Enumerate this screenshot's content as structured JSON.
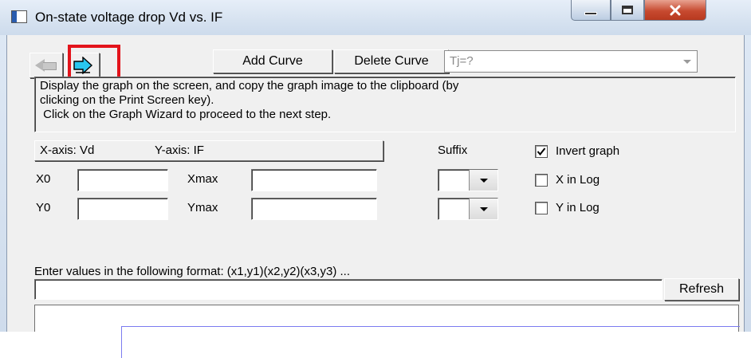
{
  "window": {
    "title": "On-state voltage drop Vd vs. IF"
  },
  "toolbar": {
    "add_curve_label": "Add Curve",
    "delete_curve_label": "Delete Curve",
    "curve_select_value": "Tj=?"
  },
  "instructions": {
    "line1": "Display the graph on the screen, and copy the graph image to the clipboard (by",
    "line2": "clicking on the Print Screen key).",
    "line3": " Click on the Graph Wizard to proceed to the next step."
  },
  "axes": {
    "x_axis_label": "X-axis: Vd",
    "y_axis_label": "Y-axis: IF"
  },
  "fields": {
    "x0_label": "X0",
    "xmax_label": "Xmax",
    "y0_label": "Y0",
    "ymax_label": "Ymax",
    "x0_value": "",
    "xmax_value": "",
    "y0_value": "",
    "ymax_value": ""
  },
  "suffix": {
    "label": "Suffix",
    "x_value": "",
    "y_value": ""
  },
  "options": {
    "invert_graph_label": "Invert graph",
    "invert_graph_checked": true,
    "x_in_log_label": "X in Log",
    "x_in_log_checked": false,
    "y_in_log_label": "Y in Log",
    "y_in_log_checked": false
  },
  "values_entry": {
    "format_hint": "Enter values in the following format:  (x1,y1)(x2,y2)(x3,y3) ...",
    "value": "",
    "refresh_label": "Refresh"
  },
  "colors": {
    "highlight": "#e3131b",
    "plot_frame": "#7b7bf0",
    "forward_arrow": "#29c6ef"
  },
  "icons": {
    "back": "back-arrow-icon",
    "forward": "forward-arrow-icon",
    "minimize": "minimize-icon",
    "maximize": "maximize-icon",
    "close": "close-icon"
  }
}
